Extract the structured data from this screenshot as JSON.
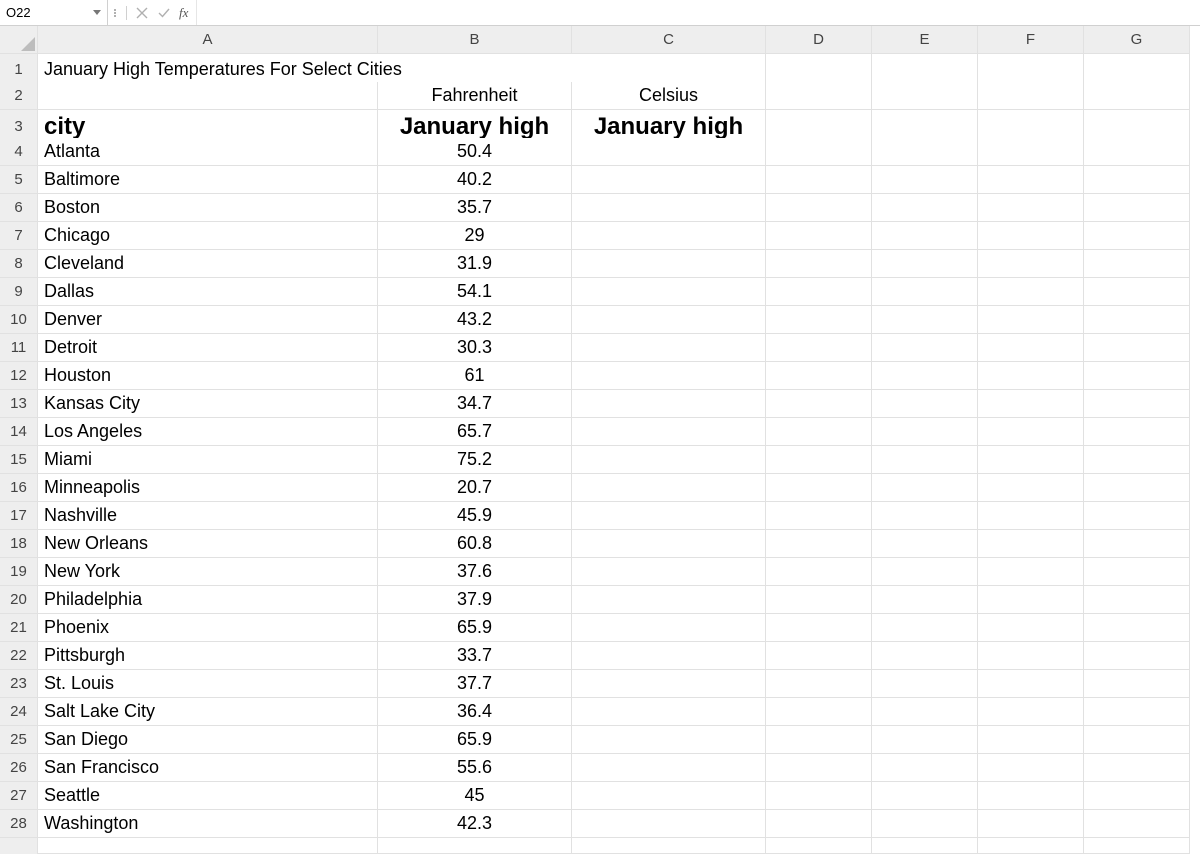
{
  "formula_bar": {
    "cell_ref": "O22",
    "fx_label": "fx",
    "formula_value": ""
  },
  "columns": [
    "A",
    "B",
    "C",
    "D",
    "E",
    "F",
    "G"
  ],
  "row_numbers": [
    1,
    2,
    3,
    4,
    5,
    6,
    7,
    8,
    9,
    10,
    11,
    12,
    13,
    14,
    15,
    16,
    17,
    18,
    19,
    20,
    21,
    22,
    23,
    24,
    25,
    26,
    27,
    28
  ],
  "title": "January High Temperatures For Select Cities",
  "unit_labels": {
    "b": "Fahrenheit",
    "c": "Celsius"
  },
  "headers": {
    "a": "city",
    "b": "January high",
    "c": "January high"
  },
  "rows": [
    {
      "city": "Atlanta",
      "f": "50.4"
    },
    {
      "city": "Baltimore",
      "f": "40.2"
    },
    {
      "city": "Boston",
      "f": "35.7"
    },
    {
      "city": "Chicago",
      "f": "29"
    },
    {
      "city": "Cleveland",
      "f": "31.9"
    },
    {
      "city": "Dallas",
      "f": "54.1"
    },
    {
      "city": "Denver",
      "f": "43.2"
    },
    {
      "city": "Detroit",
      "f": "30.3"
    },
    {
      "city": "Houston",
      "f": "61"
    },
    {
      "city": "Kansas City",
      "f": "34.7"
    },
    {
      "city": "Los Angeles",
      "f": "65.7"
    },
    {
      "city": "Miami",
      "f": "75.2"
    },
    {
      "city": "Minneapolis",
      "f": "20.7"
    },
    {
      "city": "Nashville",
      "f": "45.9"
    },
    {
      "city": "New Orleans",
      "f": "60.8"
    },
    {
      "city": "New York",
      "f": "37.6"
    },
    {
      "city": "Philadelphia",
      "f": "37.9"
    },
    {
      "city": "Phoenix",
      "f": "65.9"
    },
    {
      "city": "Pittsburgh",
      "f": "33.7"
    },
    {
      "city": "St. Louis",
      "f": "37.7"
    },
    {
      "city": "Salt Lake City",
      "f": "36.4"
    },
    {
      "city": "San Diego",
      "f": "65.9"
    },
    {
      "city": "San Francisco",
      "f": "55.6"
    },
    {
      "city": "Seattle",
      "f": "45"
    },
    {
      "city": "Washington",
      "f": "42.3"
    }
  ],
  "chart_data": {
    "type": "table",
    "title": "January High Temperatures For Select Cities",
    "columns": [
      "city",
      "January high (Fahrenheit)",
      "January high (Celsius)"
    ],
    "rows": [
      [
        "Atlanta",
        50.4,
        null
      ],
      [
        "Baltimore",
        40.2,
        null
      ],
      [
        "Boston",
        35.7,
        null
      ],
      [
        "Chicago",
        29,
        null
      ],
      [
        "Cleveland",
        31.9,
        null
      ],
      [
        "Dallas",
        54.1,
        null
      ],
      [
        "Denver",
        43.2,
        null
      ],
      [
        "Detroit",
        30.3,
        null
      ],
      [
        "Houston",
        61,
        null
      ],
      [
        "Kansas City",
        34.7,
        null
      ],
      [
        "Los Angeles",
        65.7,
        null
      ],
      [
        "Miami",
        75.2,
        null
      ],
      [
        "Minneapolis",
        20.7,
        null
      ],
      [
        "Nashville",
        45.9,
        null
      ],
      [
        "New Orleans",
        60.8,
        null
      ],
      [
        "New York",
        37.6,
        null
      ],
      [
        "Philadelphia",
        37.9,
        null
      ],
      [
        "Phoenix",
        65.9,
        null
      ],
      [
        "Pittsburgh",
        33.7,
        null
      ],
      [
        "St. Louis",
        37.7,
        null
      ],
      [
        "Salt Lake City",
        36.4,
        null
      ],
      [
        "San Diego",
        65.9,
        null
      ],
      [
        "San Francisco",
        55.6,
        null
      ],
      [
        "Seattle",
        45,
        null
      ],
      [
        "Washington",
        42.3,
        null
      ]
    ]
  }
}
